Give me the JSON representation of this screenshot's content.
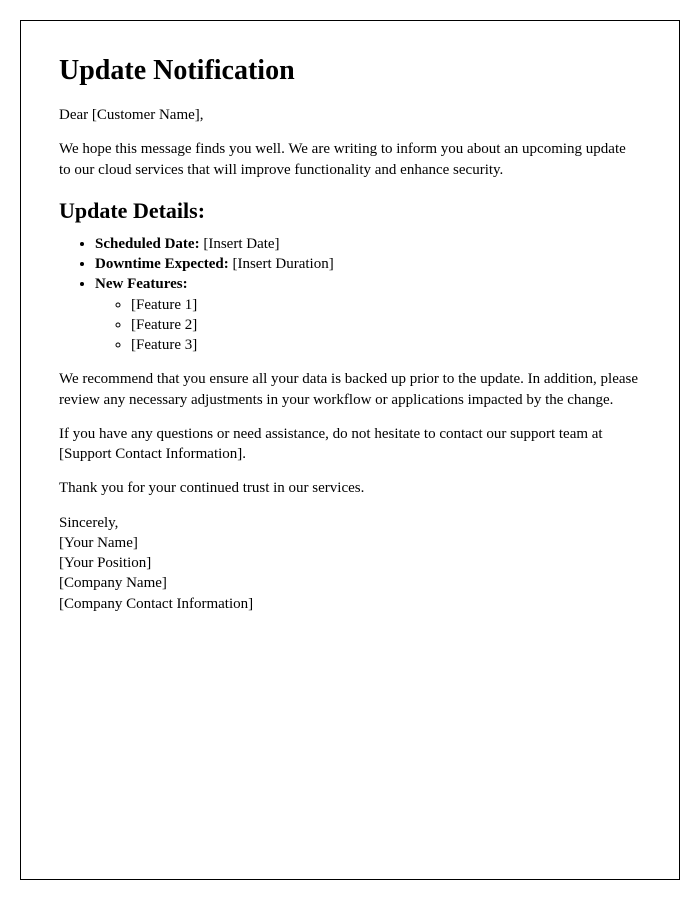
{
  "title": "Update Notification",
  "greeting": "Dear [Customer Name],",
  "intro": "We hope this message finds you well. We are writing to inform you about an upcoming update to our cloud services that will improve functionality and enhance security.",
  "details_heading": "Update Details:",
  "details": {
    "scheduled_label": "Scheduled Date:",
    "scheduled_value": " [Insert Date]",
    "downtime_label": "Downtime Expected:",
    "downtime_value": " [Insert Duration]",
    "features_label": "New Features:",
    "features": {
      "0": "[Feature 1]",
      "1": "[Feature 2]",
      "2": "[Feature 3]"
    }
  },
  "recommend": "We recommend that you ensure all your data is backed up prior to the update. In addition, please review any necessary adjustments in your workflow or applications impacted by the change.",
  "support": "If you have any questions or need assistance, do not hesitate to contact our support team at [Support Contact Information].",
  "thanks": "Thank you for your continued trust in our services.",
  "signature": {
    "closing": "Sincerely,",
    "name": "[Your Name]",
    "position": "[Your Position]",
    "company": "[Company Name]",
    "contact": "[Company Contact Information]"
  }
}
